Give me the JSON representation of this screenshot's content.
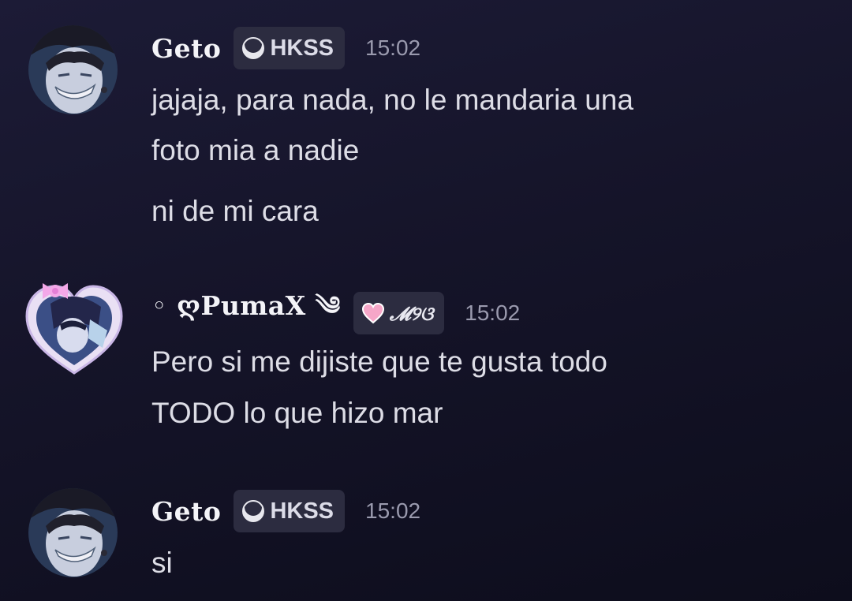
{
  "messages": [
    {
      "username": "Geto",
      "tag": {
        "label": "HKSS",
        "icon": "crescent-moon-icon"
      },
      "timestamp": "15:02",
      "lines": [
        "jajaja, para nada, no le mandaria una",
        "foto mia a nadie",
        "ni de mi cara"
      ]
    },
    {
      "username": "◦ ღPumaX ༄",
      "tag": {
        "label": "𝓜୨ଓ",
        "icon": "pink-heart-icon"
      },
      "timestamp": "15:02",
      "lines": [
        "Pero si me dijiste que te gusta todo",
        "TODO lo que hizo mar"
      ]
    },
    {
      "username": "Geto",
      "tag": {
        "label": "HKSS",
        "icon": "crescent-moon-icon"
      },
      "timestamp": "15:02",
      "lines": [
        "si"
      ]
    }
  ],
  "colors": {
    "background": "#161529",
    "tag_background": "#2c2c40",
    "timestamp": "#9a9aae",
    "text": "#dddde6"
  }
}
